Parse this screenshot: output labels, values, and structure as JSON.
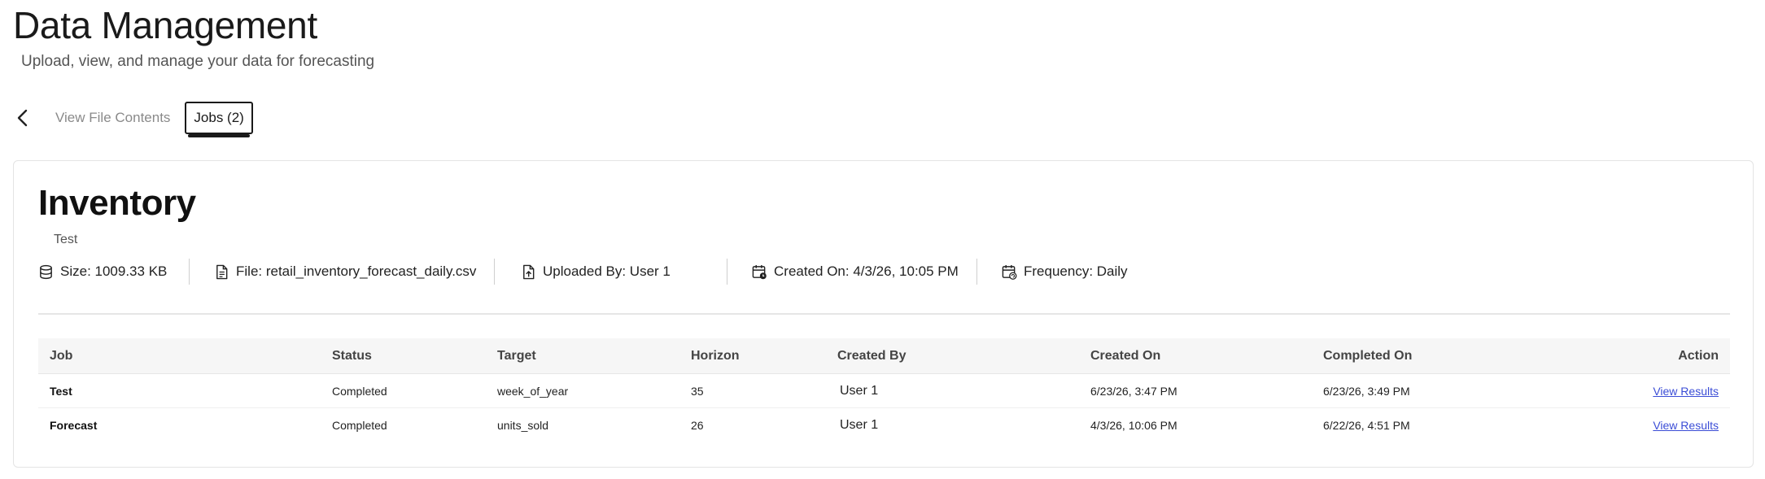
{
  "header": {
    "title": "Data Management",
    "subtitle": "Upload, view, and manage your data for forecasting"
  },
  "nav": {
    "back_icon": "chevron-left-icon",
    "tabs": [
      {
        "label": "View File Contents",
        "active": false
      },
      {
        "label": "Jobs (2)",
        "active": true
      }
    ]
  },
  "dataset": {
    "name": "Inventory",
    "description": "Test",
    "meta": {
      "size": "Size: 1009.33 KB",
      "file": "File: retail_inventory_forecast_daily.csv",
      "uploaded_by": "Uploaded By: User 1",
      "created_on": "Created On: 4/3/26, 10:05 PM",
      "frequency": "Frequency: Daily"
    }
  },
  "jobs_table": {
    "headers": [
      "Job",
      "Status",
      "Target",
      "Horizon",
      "Created By",
      "Created On",
      "Completed On",
      "Action"
    ],
    "rows": [
      {
        "job": "Test",
        "status": "Completed",
        "target": "week_of_year",
        "horizon": "35",
        "created_by": "User 1",
        "created_on": "6/23/26, 3:47 PM",
        "completed_on": "6/23/26, 3:49 PM",
        "action": "View Results"
      },
      {
        "job": "Forecast",
        "status": "Completed",
        "target": "units_sold",
        "horizon": "26",
        "created_by": "User 1",
        "created_on": "4/3/26, 10:06 PM",
        "completed_on": "6/22/26, 4:51 PM",
        "action": "View Results"
      }
    ]
  },
  "colors": {
    "link": "#3b4dd6",
    "header_bg": "#f6f6f6",
    "border": "#e4e4e4"
  }
}
